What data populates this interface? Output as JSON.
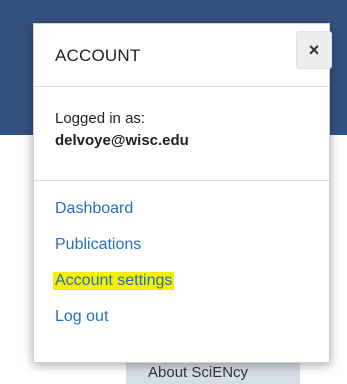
{
  "background": {
    "about_tab_label": "About SciENcy"
  },
  "account_popover": {
    "title": "ACCOUNT",
    "close_glyph": "×",
    "logged_in_label": "Logged in as:",
    "user_email": "delvoye@wisc.edu",
    "menu": [
      {
        "label": "Dashboard"
      },
      {
        "label": "Publications"
      },
      {
        "label": "Account settings",
        "highlighted": true
      },
      {
        "label": "Log out"
      }
    ]
  },
  "colors": {
    "header_bg": "#34527f",
    "link": "#2a6ebb",
    "highlight": "#f4f000"
  }
}
